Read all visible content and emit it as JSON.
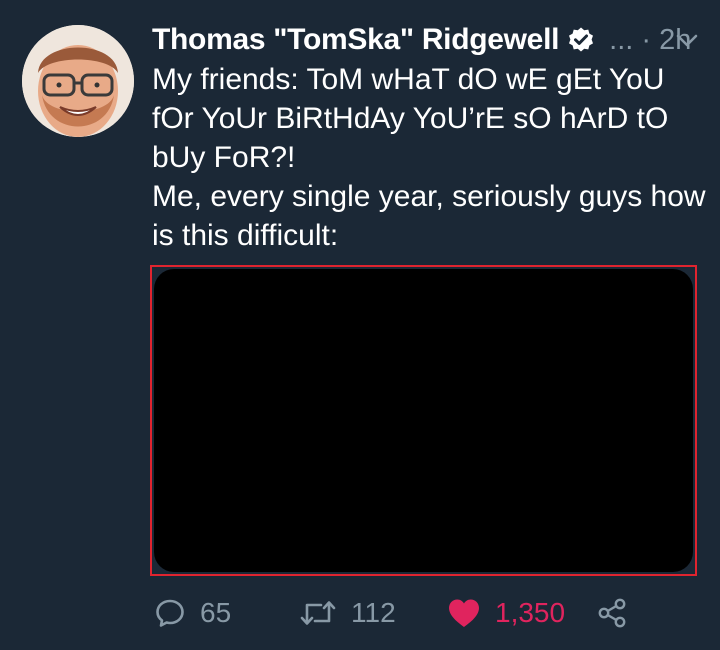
{
  "tweet": {
    "display_name": "Thomas \"TomSka\" Ridgewell",
    "meta": "... · 2h",
    "text_lines": [
      "My friends: ToM wHaT dO wE gEt YoU fOr YoUr BiRtHdAy YoU’rE sO hArD tO bUy FoR?!",
      "Me, every single year, seriously guys how is this difficult:"
    ]
  },
  "actions": {
    "reply_count": "65",
    "retweet_count": "112",
    "like_count": "1,350"
  },
  "colors": {
    "background": "#1b2836",
    "text": "#ffffff",
    "muted": "#8899a6",
    "like": "#e0245e",
    "media_outline": "#e0242f"
  },
  "icons": {
    "verified": "verified-badge-icon",
    "more": "chevron-down-icon",
    "reply": "reply-icon",
    "retweet": "retweet-icon",
    "like": "heart-icon",
    "share": "share-icon"
  }
}
